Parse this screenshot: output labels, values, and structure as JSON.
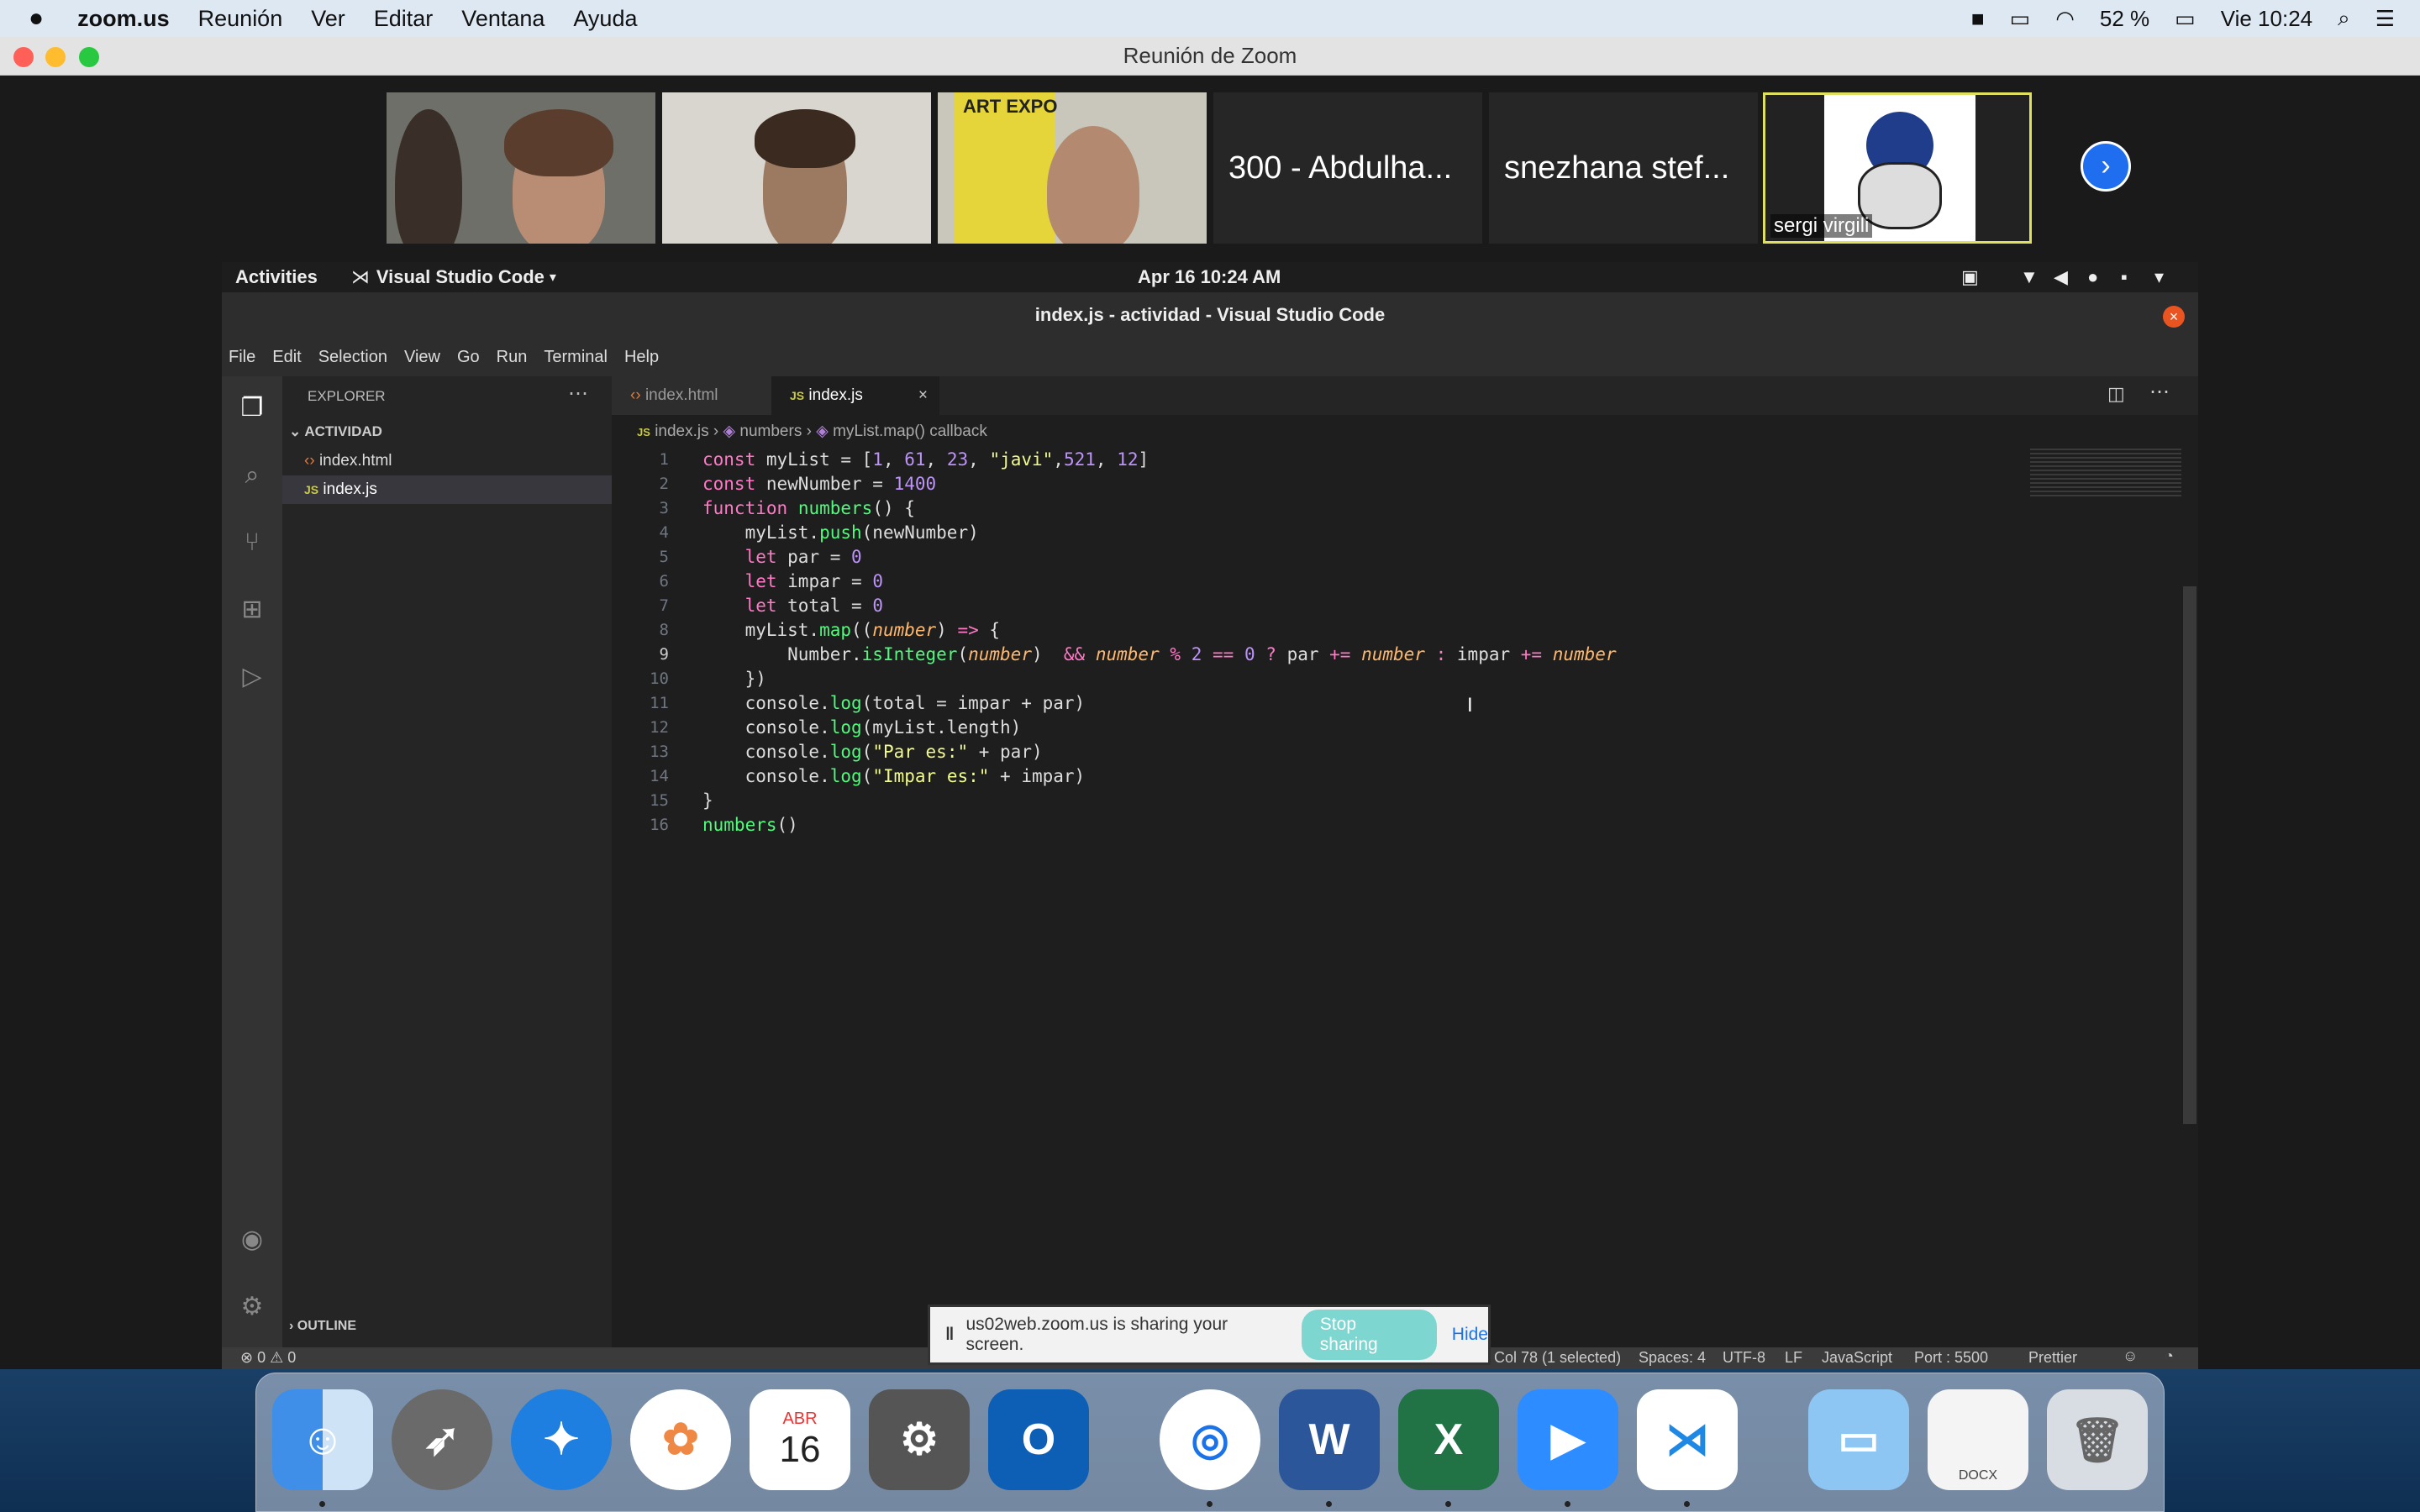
{
  "menubar": {
    "app": "zoom.us",
    "items": [
      "Reunión",
      "Ver",
      "Editar",
      "Ventana",
      "Ayuda"
    ],
    "battery": "52 %",
    "clock": "Vie 10:24"
  },
  "zoom": {
    "window_title": "Reunión de Zoom",
    "participants": [
      {
        "name": "300 - Abdulha..."
      },
      {
        "name": "snezhana stef..."
      },
      {
        "name": "sergi virgili"
      }
    ],
    "poster_text": "ART EXPO"
  },
  "ubuntu": {
    "activities": "Activities",
    "app": "Visual Studio Code",
    "clock": "Apr 16  10:24 AM"
  },
  "vscode": {
    "title": "index.js - actividad - Visual Studio Code",
    "menu": [
      "File",
      "Edit",
      "Selection",
      "View",
      "Go",
      "Run",
      "Terminal",
      "Help"
    ],
    "explorer_label": "EXPLORER",
    "folder": "ACTIVIDAD",
    "files": [
      "index.html",
      "index.js"
    ],
    "outline": "OUTLINE",
    "tabs": [
      {
        "label": "index.html"
      },
      {
        "label": "index.js"
      }
    ],
    "breadcrumb": [
      "index.js",
      "numbers",
      "myList.map() callback"
    ],
    "line_numbers": [
      "1",
      "2",
      "3",
      "4",
      "5",
      "6",
      "7",
      "8",
      "9",
      "10",
      "11",
      "12",
      "13",
      "14",
      "15",
      "16"
    ],
    "status": {
      "problems": "⊗ 0 ⚠ 0",
      "cursor": "Col 78 (1 selected)",
      "spaces": "Spaces: 4",
      "encoding": "UTF-8",
      "eol": "LF",
      "language": "JavaScript",
      "port": "Port : 5500",
      "prettier": "Prettier"
    }
  },
  "share_bar": {
    "message": "us02web.zoom.us is sharing your screen.",
    "stop": "Stop sharing",
    "hide": "Hide"
  },
  "dock": {
    "calendar_month": "ABR",
    "calendar_day": "16",
    "docx_label": "DOCX"
  }
}
